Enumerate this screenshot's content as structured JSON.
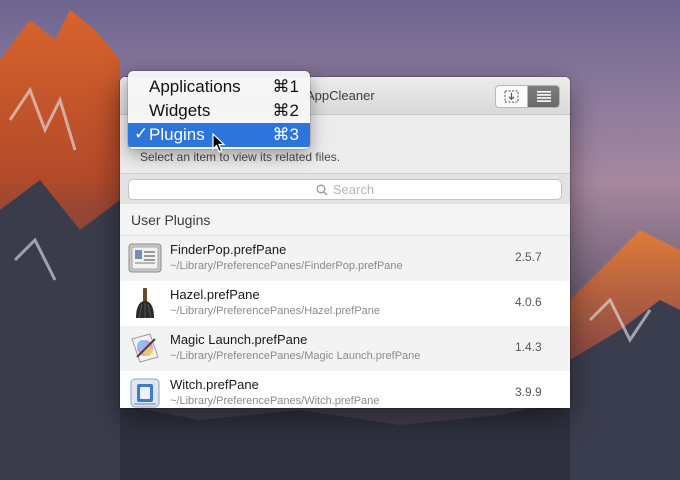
{
  "window": {
    "title": "AppCleaner",
    "subtitle": "Select an item to view its related files.",
    "search_placeholder": "Search",
    "section_title": "User Plugins"
  },
  "menu": {
    "items": [
      {
        "label": "Applications",
        "shortcut": "⌘1",
        "selected": false
      },
      {
        "label": "Widgets",
        "shortcut": "⌘2",
        "selected": false
      },
      {
        "label": "Plugins",
        "shortcut": "⌘3",
        "selected": true,
        "check": "✓"
      }
    ]
  },
  "plugins": [
    {
      "name": "FinderPop.prefPane",
      "path": "~/Library/PreferencePanes/FinderPop.prefPane",
      "version": "2.5.7",
      "icon": "finderpop-icon"
    },
    {
      "name": "Hazel.prefPane",
      "path": "~/Library/PreferencePanes/Hazel.prefPane",
      "version": "4.0.6",
      "icon": "hazel-icon"
    },
    {
      "name": "Magic Launch.prefPane",
      "path": "~/Library/PreferencePanes/Magic Launch.prefPane",
      "version": "1.4.3",
      "icon": "magic-launch-icon"
    },
    {
      "name": "Witch.prefPane",
      "path": "~/Library/PreferencePanes/Witch.prefPane",
      "version": "3.9.9",
      "icon": "witch-icon"
    }
  ],
  "colors": {
    "menu_highlight": "#2d75da",
    "window_bg": "#ffffff",
    "row_alt": "#f3f3f3"
  }
}
